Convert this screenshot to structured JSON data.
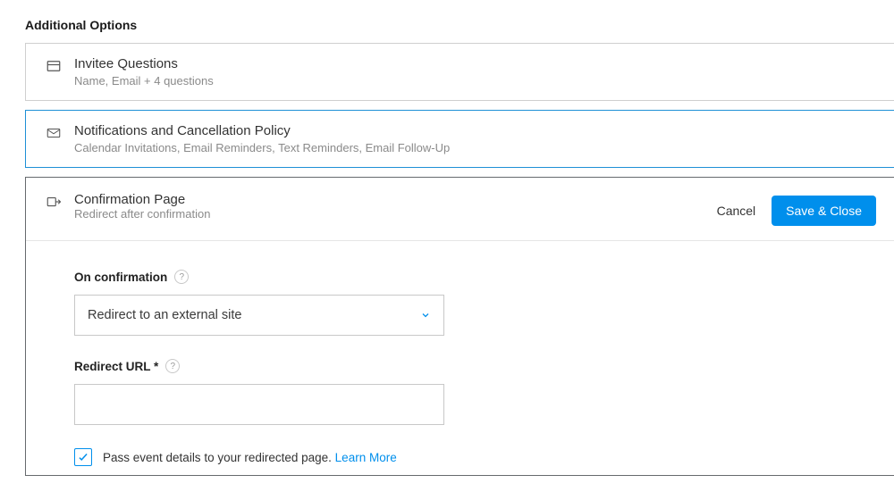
{
  "page": {
    "title": "Additional Options"
  },
  "cards": {
    "invitee": {
      "title": "Invitee Questions",
      "subtitle": "Name, Email + 4 questions"
    },
    "notifications": {
      "title": "Notifications and Cancellation Policy",
      "subtitle": "Calendar Invitations, Email Reminders, Text Reminders, Email Follow-Up"
    },
    "confirmation": {
      "title": "Confirmation Page",
      "subtitle": "Redirect after confirmation"
    }
  },
  "actions": {
    "cancel": "Cancel",
    "save_close": "Save & Close"
  },
  "form": {
    "on_confirmation_label": "On confirmation",
    "on_confirmation_value": "Redirect to an external site",
    "redirect_url_label": "Redirect URL *",
    "redirect_url_value": "",
    "pass_details_label": "Pass event details to your redirected page.",
    "pass_details_checked": true,
    "learn_more": "Learn More"
  }
}
